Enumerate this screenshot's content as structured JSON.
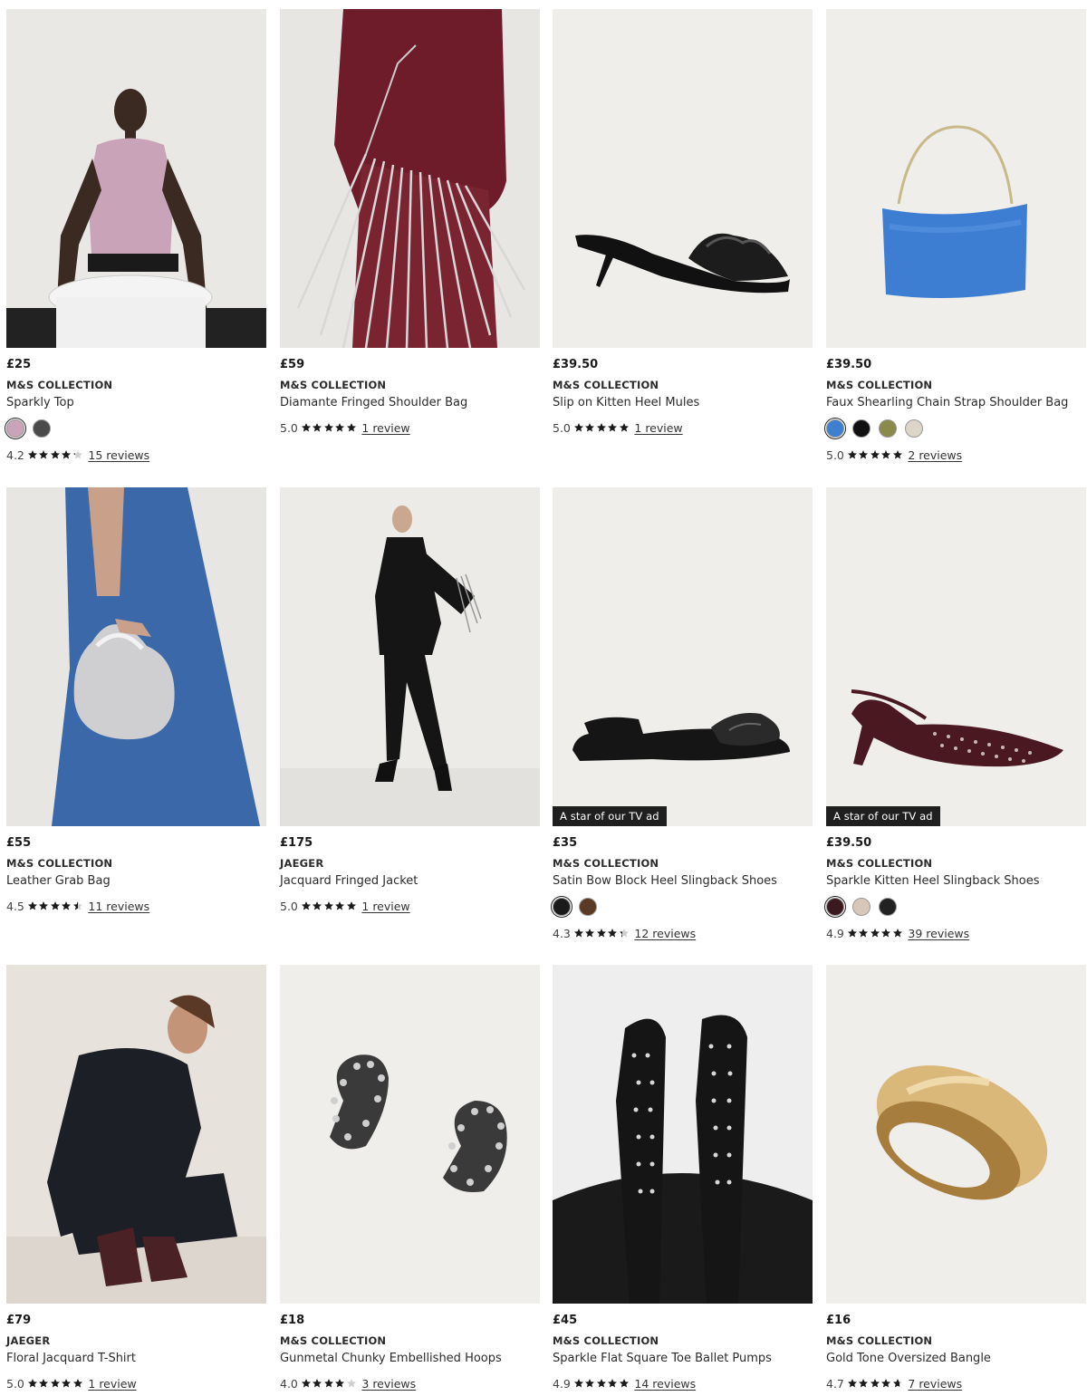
{
  "products": [
    {
      "price": "£25",
      "brand": "M&S COLLECTION",
      "name": "Sparkly Top",
      "badge": "",
      "swatches": [
        "#c9a3b8",
        "#4a4a4a"
      ],
      "rating": "4.2",
      "stars": 4.2,
      "reviews": "15 reviews",
      "image": "woman-sparkly-top"
    },
    {
      "price": "£59",
      "brand": "M&S COLLECTION",
      "name": "Diamante Fringed Shoulder Bag",
      "badge": "",
      "swatches": [],
      "rating": "5.0",
      "stars": 5,
      "reviews": "1 review",
      "image": "fringed-bag"
    },
    {
      "price": "£39.50",
      "brand": "M&S COLLECTION",
      "name": "Slip on Kitten Heel Mules",
      "badge": "",
      "swatches": [],
      "rating": "5.0",
      "stars": 5,
      "reviews": "1 review",
      "image": "kitten-mule"
    },
    {
      "price": "£39.50",
      "brand": "M&S COLLECTION",
      "name": "Faux Shearling Chain Strap Shoulder Bag",
      "badge": "",
      "swatches": [
        "#3f7fd0",
        "#111111",
        "#8a8a4a",
        "#ddd6c8"
      ],
      "rating": "5.0",
      "stars": 5,
      "reviews": "2 reviews",
      "image": "blue-shearling-bag"
    },
    {
      "price": "£55",
      "brand": "M&S COLLECTION",
      "name": "Leather Grab Bag",
      "badge": "",
      "swatches": [],
      "rating": "4.5",
      "stars": 4.5,
      "reviews": "11 reviews",
      "image": "silver-grab-bag"
    },
    {
      "price": "£175",
      "brand": "JAEGER",
      "name": "Jacquard Fringed Jacket",
      "badge": "",
      "swatches": [],
      "rating": "5.0",
      "stars": 5,
      "reviews": "1 review",
      "image": "black-suit"
    },
    {
      "price": "£35",
      "brand": "M&S COLLECTION",
      "name": "Satin Bow Block Heel Slingback Shoes",
      "badge": "A star of our TV ad",
      "swatches": [
        "#1a1a1a",
        "#5a3a22"
      ],
      "rating": "4.3",
      "stars": 4.3,
      "reviews": "12 reviews",
      "image": "black-slingback"
    },
    {
      "price": "£39.50",
      "brand": "M&S COLLECTION",
      "name": "Sparkle Kitten Heel Slingback Shoes",
      "badge": "A star of our TV ad",
      "swatches": [
        "#3a1a1e",
        "#d8c6b8",
        "#222222"
      ],
      "rating": "4.9",
      "stars": 5,
      "reviews": "39 reviews",
      "image": "burgundy-slingback"
    },
    {
      "price": "£79",
      "brand": "JAEGER",
      "name": "Floral Jacquard T-Shirt",
      "badge": "",
      "swatches": [],
      "rating": "5.0",
      "stars": 5,
      "reviews": "1 review",
      "image": "woman-black-outfit"
    },
    {
      "price": "£18",
      "brand": "M&S COLLECTION",
      "name": "Gunmetal Chunky Embellished Hoops",
      "badge": "",
      "swatches": [],
      "rating": "4.0",
      "stars": 4,
      "reviews": "3 reviews",
      "image": "embellished-hoops"
    },
    {
      "price": "£45",
      "brand": "M&S COLLECTION",
      "name": "Sparkle Flat Square Toe Ballet Pumps",
      "badge": "",
      "swatches": [],
      "rating": "4.9",
      "stars": 5,
      "reviews": "14 reviews",
      "image": "studded-pumps"
    },
    {
      "price": "£16",
      "brand": "M&S COLLECTION",
      "name": "Gold Tone Oversized Bangle",
      "badge": "",
      "swatches": [],
      "rating": "4.7",
      "stars": 4.7,
      "reviews": "7 reviews",
      "image": "gold-bangle"
    }
  ]
}
